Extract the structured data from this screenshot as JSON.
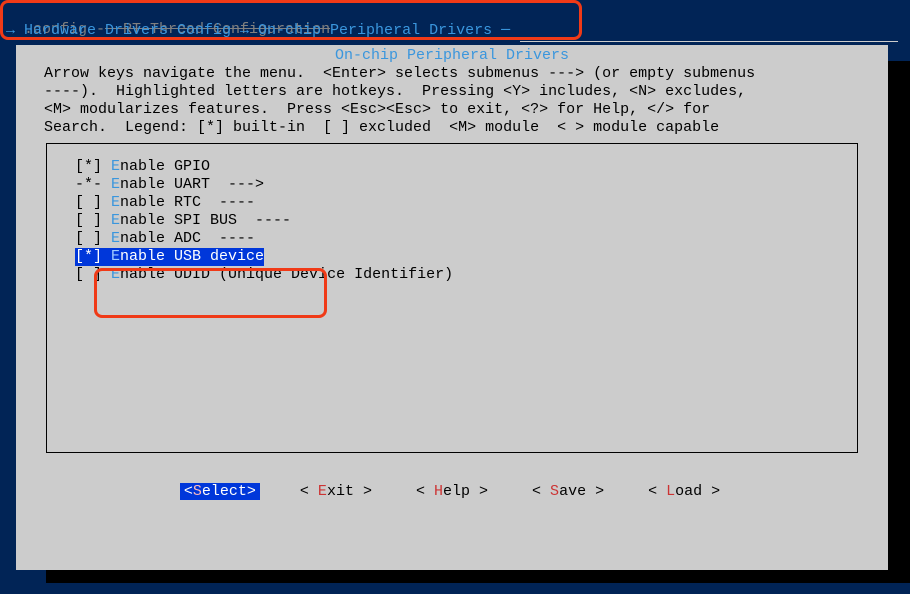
{
  "top_line": {
    "left": ".config -",
    "struck": "  RT-Thread Configuration"
  },
  "breadcrumb": "→ Hardware Drivers Config → On-chip Peripheral Drivers ─",
  "dialog_title": "On-chip Peripheral Drivers",
  "help_text": "Arrow keys navigate the menu.  <Enter> selects submenus ---> (or empty submenus\n----).  Highlighted letters are hotkeys.  Pressing <Y> includes, <N> excludes,\n<M> modularizes features.  Press <Esc><Esc> to exit, <?> for Help, </> for\nSearch.  Legend: [*] built-in  [ ] excluded  <M> module  < > module capable",
  "menu_items": [
    {
      "prefix": "[*] ",
      "hot": "E",
      "rest": "nable GPIO"
    },
    {
      "prefix": "-*- ",
      "hot": "E",
      "rest": "nable UART  --->"
    },
    {
      "prefix": "[ ] ",
      "hot": "E",
      "rest": "nable RTC  ----"
    },
    {
      "prefix": "[ ] ",
      "hot": "E",
      "rest": "nable SPI BUS  ----"
    },
    {
      "prefix": "[ ] ",
      "hot": "E",
      "rest": "nable ADC  ----"
    },
    {
      "prefix": "[*] ",
      "hot": "E",
      "rest": "nable USB device",
      "selected": true
    },
    {
      "prefix": "[ ] ",
      "hot": "E",
      "rest": "nable UDID (Unique Device Identifier)"
    }
  ],
  "buttons": [
    {
      "left": "<",
      "hot": "S",
      "rest": "elect>",
      "selected": true
    },
    {
      "left": "< ",
      "hot": "E",
      "rest": "xit >"
    },
    {
      "left": "< ",
      "hot": "H",
      "rest": "elp >"
    },
    {
      "left": "< ",
      "hot": "S",
      "rest": "ave >"
    },
    {
      "left": "< ",
      "hot": "L",
      "rest": "oad >"
    }
  ]
}
